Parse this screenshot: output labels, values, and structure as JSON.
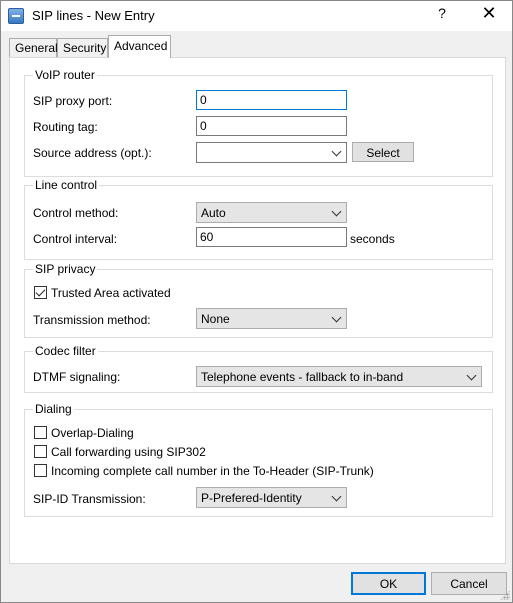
{
  "window": {
    "title": "SIP lines - New Entry",
    "help_glyph": "?",
    "close_glyph": "✕"
  },
  "tabs": [
    {
      "label": "General"
    },
    {
      "label": "Security"
    },
    {
      "label": "Advanced",
      "active": true
    }
  ],
  "voip_router": {
    "group_label": "VoIP router",
    "sip_proxy_port": {
      "label": "SIP proxy port:",
      "value": "0"
    },
    "routing_tag": {
      "label": "Routing tag:",
      "value": "0"
    },
    "source_address": {
      "label": "Source address (opt.):",
      "value": ""
    },
    "select_button": "Select"
  },
  "line_control": {
    "group_label": "Line control",
    "control_method": {
      "label": "Control method:",
      "value": "Auto"
    },
    "control_interval": {
      "label": "Control interval:",
      "value": "60",
      "unit": "seconds"
    }
  },
  "sip_privacy": {
    "group_label": "SIP privacy",
    "trusted_area": {
      "label": "Trusted Area activated",
      "checked": true
    },
    "transmission_method": {
      "label": "Transmission method:",
      "value": "None"
    }
  },
  "codec_filter": {
    "group_label": "Codec filter",
    "dtmf_signaling": {
      "label": "DTMF signaling:",
      "value": "Telephone events - fallback to in-band"
    }
  },
  "dialing": {
    "group_label": "Dialing",
    "overlap_dialing": {
      "label": "Overlap-Dialing",
      "checked": false
    },
    "call_forwarding": {
      "label": "Call forwarding using SIP302",
      "checked": false
    },
    "incoming_complete": {
      "label": "Incoming complete call number in the To-Header (SIP-Trunk)",
      "checked": false
    },
    "sip_id_transmission": {
      "label": "SIP-ID Transmission:",
      "value": "P-Prefered-Identity"
    }
  },
  "footer": {
    "ok_label": "OK",
    "cancel_label": "Cancel"
  },
  "colors": {
    "focus_accent": "#0078d7",
    "window_bg": "#f0f0f0"
  }
}
